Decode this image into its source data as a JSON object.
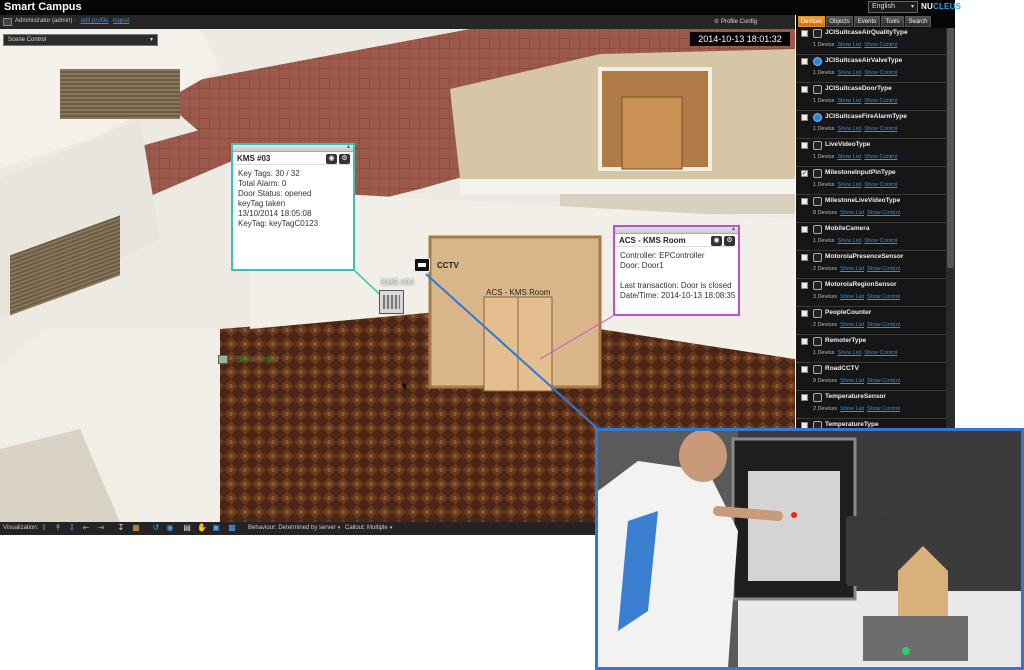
{
  "app": {
    "title": "Smart Campus",
    "brand_a": "NU",
    "brand_b": "CLEUS",
    "brand_accent": "#2aa3e8"
  },
  "language": {
    "value": "English"
  },
  "user": {
    "label": "Administrator (admin) ·",
    "edit_profile": "edit profile",
    "logout": "logout"
  },
  "profile_config": "Profile Config",
  "scene": {
    "value": "Scene Control"
  },
  "viewport": {
    "timestamp": "2014-10-13 18:01:32"
  },
  "kms_popup": {
    "title": "KMS #03",
    "lines": [
      "Key Tags: 30 / 32",
      "Total Alarm: 0",
      "Door Status: opened",
      "keyTag taken",
      "13/10/2014 18:05:08",
      "KeyTag: keyTagC0123"
    ]
  },
  "acs_popup": {
    "title": "ACS - KMS Room",
    "lines": [
      "Controller: EPController",
      "Door: Door1",
      "",
      "Last transaction: Door is closed",
      "Date/Time: 2014-10-13 18:08:35"
    ]
  },
  "scene_labels": {
    "cctv": "CCTV",
    "kms": "KMS #03",
    "room": "ACS - KMS Room",
    "smoke": "SmokeInput"
  },
  "toolbar": {
    "visualization": "Visualization:",
    "behaviour": "Behaviour: Determined by server",
    "callout": "Callout: Multiple"
  },
  "tabs": [
    "Devices",
    "Objects",
    "Events",
    "Tools",
    "Search"
  ],
  "device_links": {
    "show_list": "Show List",
    "show_control": "Show Control"
  },
  "devices": [
    {
      "name": "JCISuitcaseAirQualityType",
      "count": "1 Device",
      "checked": false,
      "icon": "sensor-icon"
    },
    {
      "name": "JCISuitcaseAirValveType",
      "count": "1 Device",
      "checked": false,
      "icon": "valve-icon"
    },
    {
      "name": "JCISuitcaseDoorType",
      "count": "1 Device",
      "checked": false,
      "icon": "door-icon"
    },
    {
      "name": "JCISuitcaseFireAlarmType",
      "count": "1 Device",
      "checked": false,
      "icon": "fire-alarm-icon"
    },
    {
      "name": "LiveVideoType",
      "count": "1 Device",
      "checked": false,
      "icon": "video-icon"
    },
    {
      "name": "MilestoneInputPinType",
      "count": "1 Device",
      "checked": true,
      "icon": "input-pin-icon"
    },
    {
      "name": "MilestoneLiveVideoType",
      "count": "8 Devices",
      "checked": false,
      "icon": "video-icon"
    },
    {
      "name": "MobileCamera",
      "count": "1 Device",
      "checked": false,
      "icon": "camera-icon"
    },
    {
      "name": "MotorolaPresenceSensor",
      "count": "2 Devices",
      "checked": false,
      "icon": "presence-sensor-icon"
    },
    {
      "name": "MotorolaRegionSensor",
      "count": "3 Devices",
      "checked": false,
      "icon": "region-sensor-icon"
    },
    {
      "name": "PeopleCounter",
      "count": "2 Devices",
      "checked": false,
      "icon": "people-counter-icon"
    },
    {
      "name": "RemoterType",
      "count": "1 Device",
      "checked": false,
      "icon": "remote-icon"
    },
    {
      "name": "RoadCCTV",
      "count": "9 Devices",
      "checked": false,
      "icon": "cctv-icon"
    },
    {
      "name": "TemperatureSensor",
      "count": "2 Devices",
      "checked": false,
      "icon": "thermometer-icon"
    },
    {
      "name": "TemperatureType",
      "count": "",
      "checked": false,
      "icon": "thermometer-icon"
    }
  ]
}
